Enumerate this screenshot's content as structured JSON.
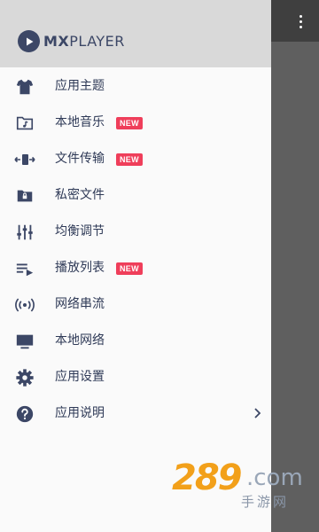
{
  "app": {
    "brand_bold": "MX",
    "brand_light": "PLAYER",
    "accent": "#3c4766",
    "badge_color": "#ef3e5a"
  },
  "menu": {
    "items": [
      {
        "label": "应用主题",
        "icon": "shirt-icon"
      },
      {
        "label": "本地音乐",
        "icon": "music-folder-icon",
        "badge": "NEW"
      },
      {
        "label": "文件传输",
        "icon": "file-transfer-icon",
        "badge": "NEW"
      },
      {
        "label": "私密文件",
        "icon": "lock-folder-icon"
      },
      {
        "label": "均衡调节",
        "icon": "equalizer-icon"
      },
      {
        "label": "播放列表",
        "icon": "playlist-icon",
        "badge": "NEW"
      },
      {
        "label": "网络串流",
        "icon": "stream-icon"
      },
      {
        "label": "本地网络",
        "icon": "monitor-icon"
      },
      {
        "label": "应用设置",
        "icon": "gear-icon"
      },
      {
        "label": "应用说明",
        "icon": "help-icon",
        "chevron": "chevron-right-icon"
      }
    ]
  },
  "watermark": {
    "number": "289",
    "domain": ".com",
    "subtitle": "手游网"
  }
}
